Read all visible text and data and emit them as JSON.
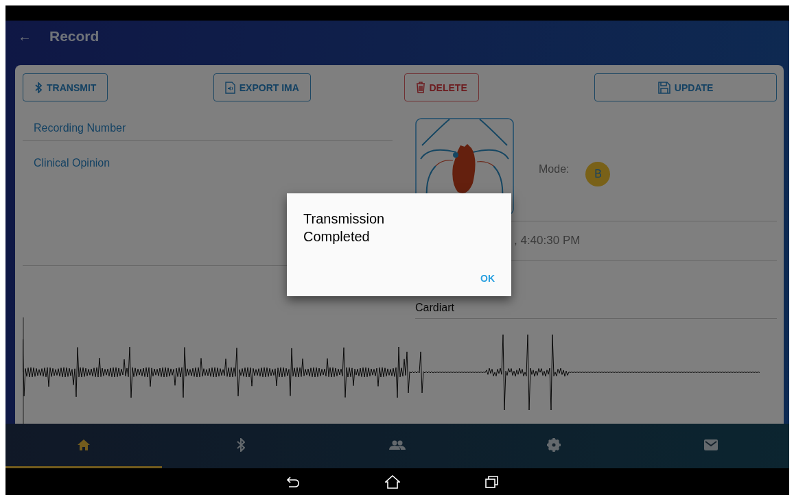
{
  "header": {
    "back_icon": "←",
    "title": "Record"
  },
  "actions": [
    {
      "kind": "transmit",
      "label": "TRANSMIT"
    },
    {
      "kind": "export",
      "label": "EXPORT IMA"
    },
    {
      "kind": "delete",
      "label": "DELETE"
    },
    {
      "kind": "update",
      "label": "UPDATE"
    }
  ],
  "fields": [
    {
      "label": "Recording Number"
    },
    {
      "label": "Clinical Opinion"
    }
  ],
  "mode": {
    "label": "Mode:",
    "value": "B"
  },
  "details": [
    {
      "value": ", 4:40:30 PM"
    },
    {
      "value": "Cardiart"
    }
  ],
  "dialog": {
    "title": "Transmission Completed",
    "button": "OK"
  },
  "bottom_nav": [
    {
      "kind": "home",
      "selected": true
    },
    {
      "kind": "bluetooth",
      "selected": false
    },
    {
      "kind": "people",
      "selected": false
    },
    {
      "kind": "settings",
      "selected": false
    },
    {
      "kind": "mail",
      "selected": false
    }
  ]
}
